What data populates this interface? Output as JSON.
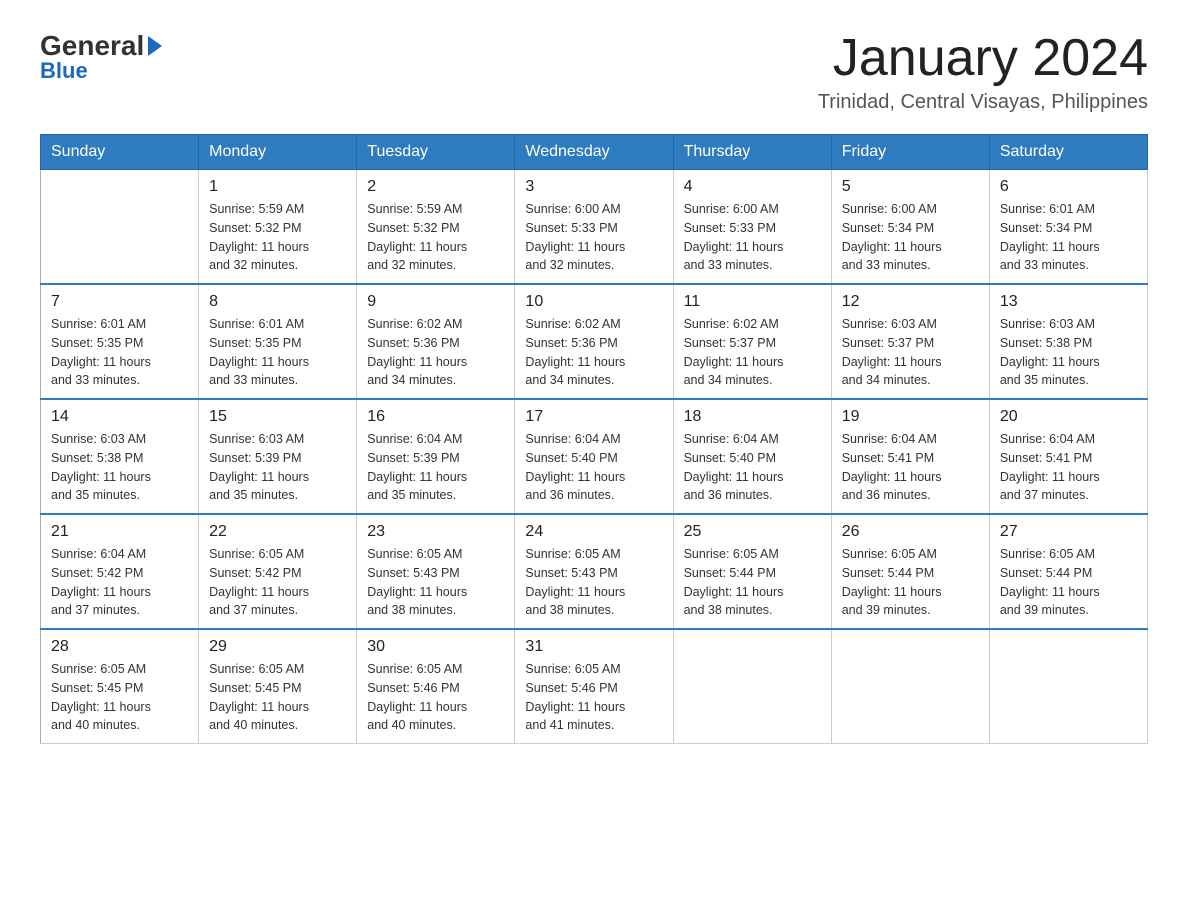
{
  "logo": {
    "general": "General",
    "blue": "Blue"
  },
  "header": {
    "month_title": "January 2024",
    "location": "Trinidad, Central Visayas, Philippines"
  },
  "weekdays": [
    "Sunday",
    "Monday",
    "Tuesday",
    "Wednesday",
    "Thursday",
    "Friday",
    "Saturday"
  ],
  "weeks": [
    [
      {
        "day": "",
        "info": ""
      },
      {
        "day": "1",
        "info": "Sunrise: 5:59 AM\nSunset: 5:32 PM\nDaylight: 11 hours\nand 32 minutes."
      },
      {
        "day": "2",
        "info": "Sunrise: 5:59 AM\nSunset: 5:32 PM\nDaylight: 11 hours\nand 32 minutes."
      },
      {
        "day": "3",
        "info": "Sunrise: 6:00 AM\nSunset: 5:33 PM\nDaylight: 11 hours\nand 32 minutes."
      },
      {
        "day": "4",
        "info": "Sunrise: 6:00 AM\nSunset: 5:33 PM\nDaylight: 11 hours\nand 33 minutes."
      },
      {
        "day": "5",
        "info": "Sunrise: 6:00 AM\nSunset: 5:34 PM\nDaylight: 11 hours\nand 33 minutes."
      },
      {
        "day": "6",
        "info": "Sunrise: 6:01 AM\nSunset: 5:34 PM\nDaylight: 11 hours\nand 33 minutes."
      }
    ],
    [
      {
        "day": "7",
        "info": "Sunrise: 6:01 AM\nSunset: 5:35 PM\nDaylight: 11 hours\nand 33 minutes."
      },
      {
        "day": "8",
        "info": "Sunrise: 6:01 AM\nSunset: 5:35 PM\nDaylight: 11 hours\nand 33 minutes."
      },
      {
        "day": "9",
        "info": "Sunrise: 6:02 AM\nSunset: 5:36 PM\nDaylight: 11 hours\nand 34 minutes."
      },
      {
        "day": "10",
        "info": "Sunrise: 6:02 AM\nSunset: 5:36 PM\nDaylight: 11 hours\nand 34 minutes."
      },
      {
        "day": "11",
        "info": "Sunrise: 6:02 AM\nSunset: 5:37 PM\nDaylight: 11 hours\nand 34 minutes."
      },
      {
        "day": "12",
        "info": "Sunrise: 6:03 AM\nSunset: 5:37 PM\nDaylight: 11 hours\nand 34 minutes."
      },
      {
        "day": "13",
        "info": "Sunrise: 6:03 AM\nSunset: 5:38 PM\nDaylight: 11 hours\nand 35 minutes."
      }
    ],
    [
      {
        "day": "14",
        "info": "Sunrise: 6:03 AM\nSunset: 5:38 PM\nDaylight: 11 hours\nand 35 minutes."
      },
      {
        "day": "15",
        "info": "Sunrise: 6:03 AM\nSunset: 5:39 PM\nDaylight: 11 hours\nand 35 minutes."
      },
      {
        "day": "16",
        "info": "Sunrise: 6:04 AM\nSunset: 5:39 PM\nDaylight: 11 hours\nand 35 minutes."
      },
      {
        "day": "17",
        "info": "Sunrise: 6:04 AM\nSunset: 5:40 PM\nDaylight: 11 hours\nand 36 minutes."
      },
      {
        "day": "18",
        "info": "Sunrise: 6:04 AM\nSunset: 5:40 PM\nDaylight: 11 hours\nand 36 minutes."
      },
      {
        "day": "19",
        "info": "Sunrise: 6:04 AM\nSunset: 5:41 PM\nDaylight: 11 hours\nand 36 minutes."
      },
      {
        "day": "20",
        "info": "Sunrise: 6:04 AM\nSunset: 5:41 PM\nDaylight: 11 hours\nand 37 minutes."
      }
    ],
    [
      {
        "day": "21",
        "info": "Sunrise: 6:04 AM\nSunset: 5:42 PM\nDaylight: 11 hours\nand 37 minutes."
      },
      {
        "day": "22",
        "info": "Sunrise: 6:05 AM\nSunset: 5:42 PM\nDaylight: 11 hours\nand 37 minutes."
      },
      {
        "day": "23",
        "info": "Sunrise: 6:05 AM\nSunset: 5:43 PM\nDaylight: 11 hours\nand 38 minutes."
      },
      {
        "day": "24",
        "info": "Sunrise: 6:05 AM\nSunset: 5:43 PM\nDaylight: 11 hours\nand 38 minutes."
      },
      {
        "day": "25",
        "info": "Sunrise: 6:05 AM\nSunset: 5:44 PM\nDaylight: 11 hours\nand 38 minutes."
      },
      {
        "day": "26",
        "info": "Sunrise: 6:05 AM\nSunset: 5:44 PM\nDaylight: 11 hours\nand 39 minutes."
      },
      {
        "day": "27",
        "info": "Sunrise: 6:05 AM\nSunset: 5:44 PM\nDaylight: 11 hours\nand 39 minutes."
      }
    ],
    [
      {
        "day": "28",
        "info": "Sunrise: 6:05 AM\nSunset: 5:45 PM\nDaylight: 11 hours\nand 40 minutes."
      },
      {
        "day": "29",
        "info": "Sunrise: 6:05 AM\nSunset: 5:45 PM\nDaylight: 11 hours\nand 40 minutes."
      },
      {
        "day": "30",
        "info": "Sunrise: 6:05 AM\nSunset: 5:46 PM\nDaylight: 11 hours\nand 40 minutes."
      },
      {
        "day": "31",
        "info": "Sunrise: 6:05 AM\nSunset: 5:46 PM\nDaylight: 11 hours\nand 41 minutes."
      },
      {
        "day": "",
        "info": ""
      },
      {
        "day": "",
        "info": ""
      },
      {
        "day": "",
        "info": ""
      }
    ]
  ]
}
